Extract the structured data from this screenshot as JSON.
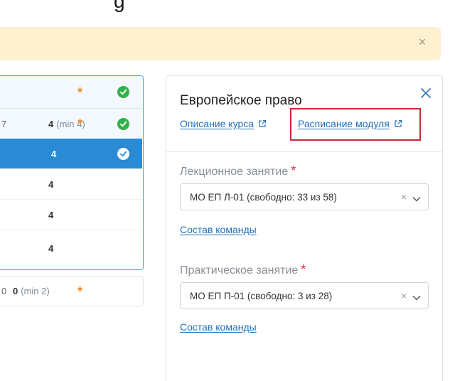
{
  "top_fragment_text": "g",
  "alert": {
    "close_glyph": "×"
  },
  "table": {
    "rows": [
      {
        "num": "",
        "min": "",
        "star": "*",
        "checked": true
      },
      {
        "prefix": "7",
        "num": "4",
        "min": "(min 4)",
        "star": "*",
        "checked": true
      },
      {
        "num": "4",
        "checked": true
      },
      {
        "num": "4"
      },
      {
        "num": "4"
      },
      {
        "num": "4"
      }
    ],
    "below": {
      "prefix": "0",
      "num": "0",
      "min": "(min 2)",
      "star": "*"
    }
  },
  "panel": {
    "title": "Европейское право",
    "links": {
      "course_description": "Описание курса",
      "module_schedule": "Расписание модуля"
    },
    "lecture": {
      "label": "Лекционное занятие",
      "required": "*",
      "selected": "МО ЕП Л-01 (свободно: 33 из 58)",
      "clear_glyph": "×",
      "team_link": "Состав команды"
    },
    "practice": {
      "label": "Практическое занятие",
      "required": "*",
      "selected": "МО ЕП П-01 (свободно: 3 из 28)",
      "clear_glyph": "×",
      "team_link": "Состав команды"
    }
  },
  "colors": {
    "accent": "#2a8ad4",
    "link": "#1f6fb8",
    "warning_bg": "#fdf1cf",
    "success": "#33b14b",
    "required": "#e0263c",
    "highlight": "#cc2a3a"
  }
}
